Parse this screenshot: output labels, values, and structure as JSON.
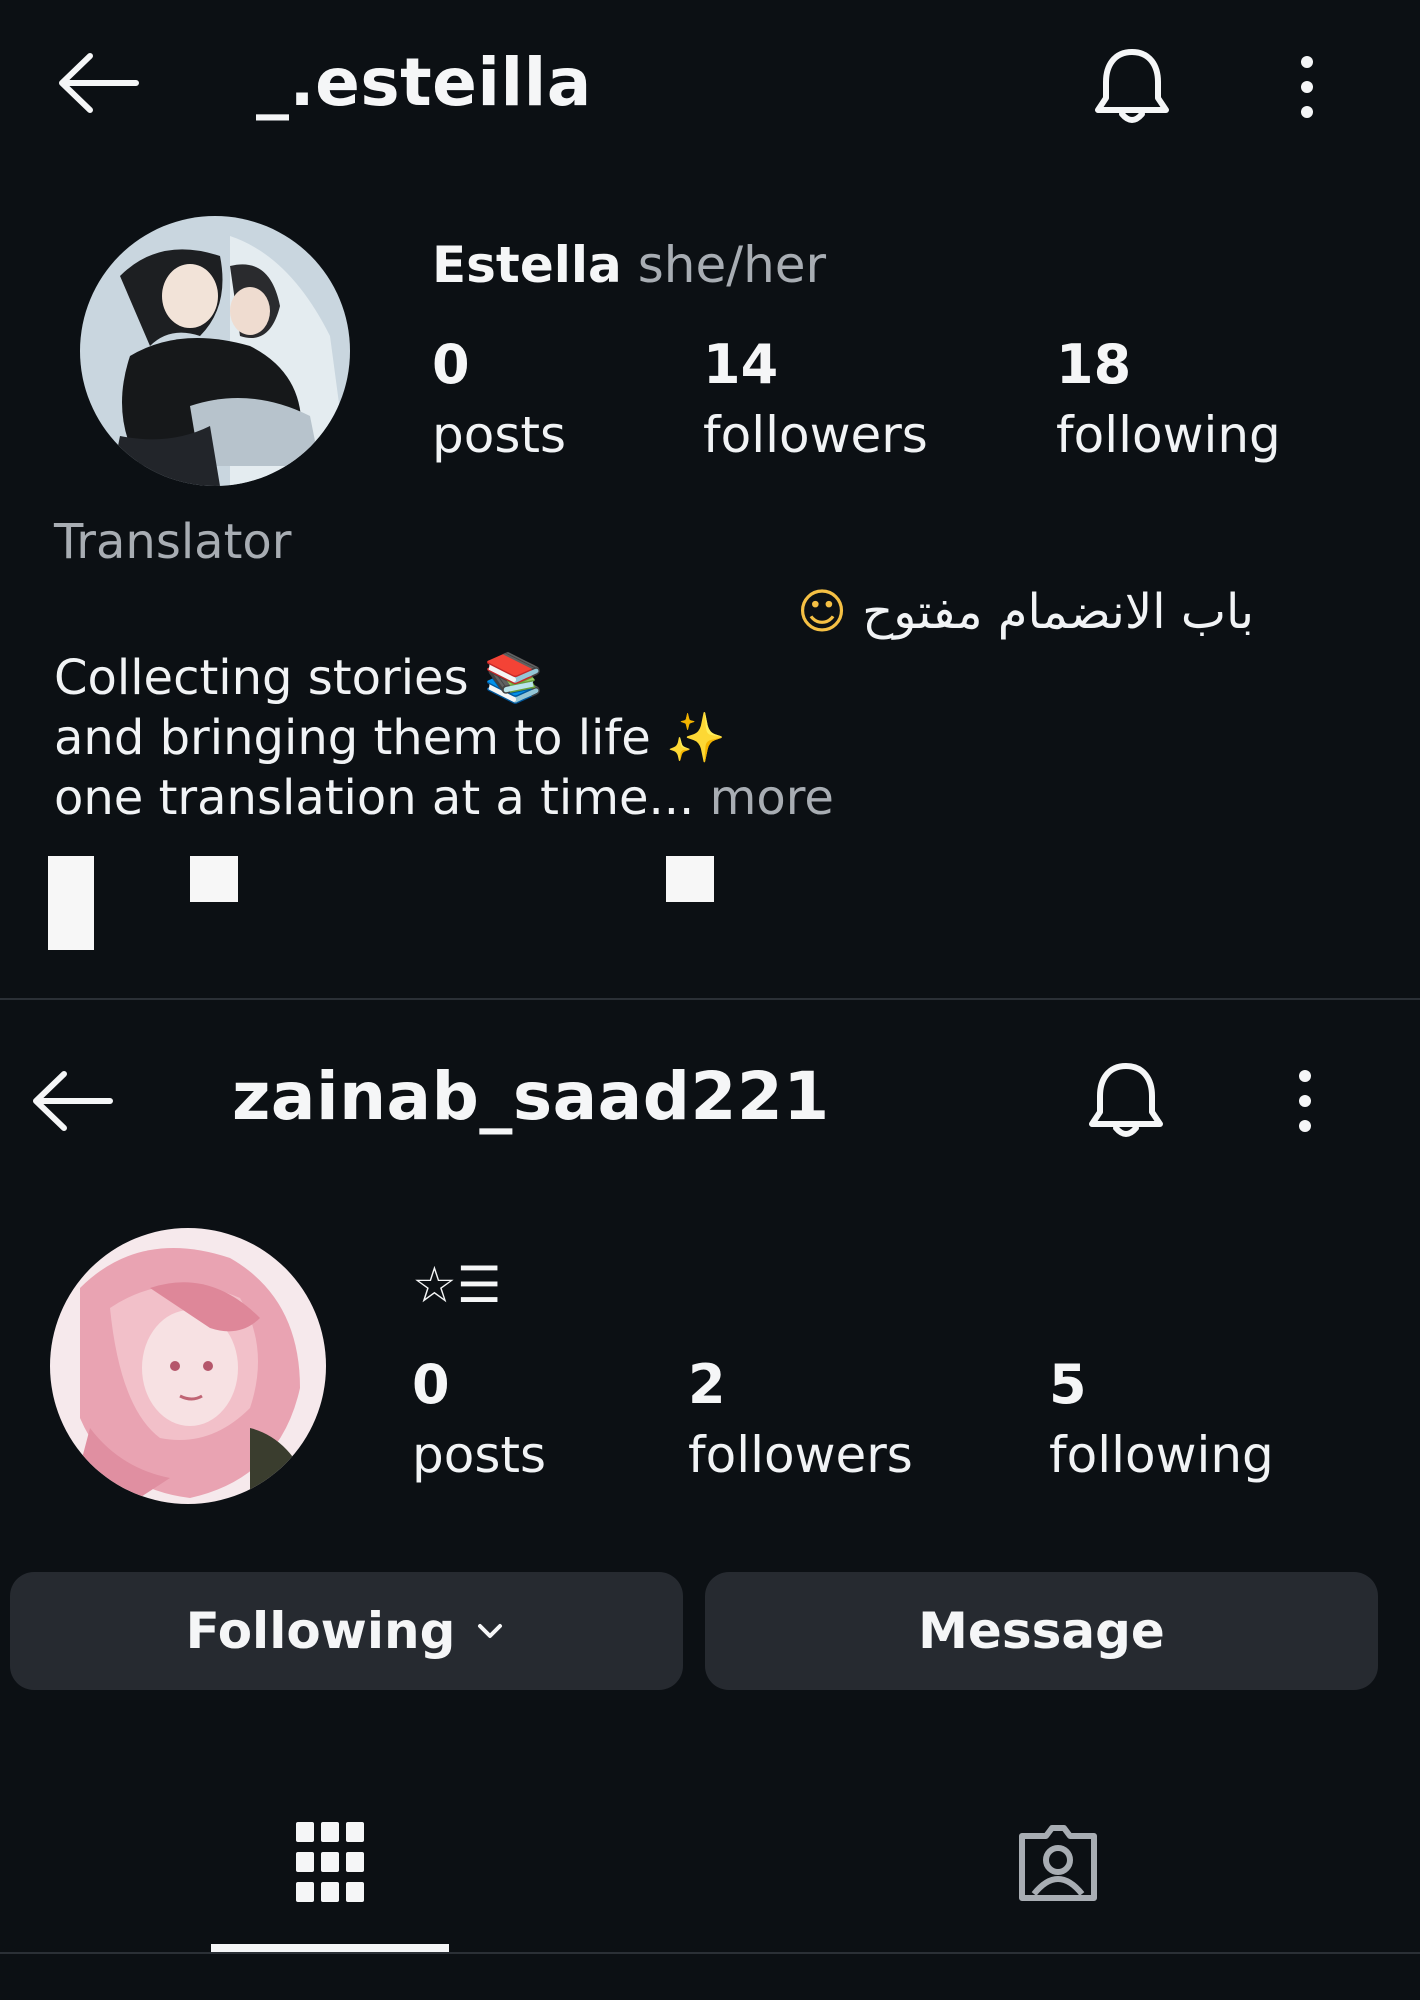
{
  "top_profile": {
    "username": "_.esteilla",
    "display_name": "Estella",
    "pronouns": "she/her",
    "stats": [
      {
        "value": "0",
        "label": "posts"
      },
      {
        "value": "14",
        "label": "followers"
      },
      {
        "value": "18",
        "label": "following"
      }
    ],
    "bio": {
      "category": "Translator",
      "arabic_line": "باب الانضمام مفتوح",
      "arabic_emoji": "☺",
      "line1": "Collecting stories",
      "line1_emoji": "📚",
      "line2": "and bringing them to life",
      "line2_emoji": "✨",
      "line3": "one translation at a time...",
      "more": "more"
    }
  },
  "bottom_profile": {
    "username": "zainab_saad221",
    "display_name": "☆☰",
    "stats": [
      {
        "value": "0",
        "label": "posts"
      },
      {
        "value": "2",
        "label": "followers"
      },
      {
        "value": "5",
        "label": "following"
      }
    ],
    "buttons": {
      "following": "Following",
      "message": "Message"
    }
  },
  "icons": {
    "back": "arrow-left-icon",
    "bell": "bell-icon",
    "more": "more-vertical-icon",
    "grid": "grid-icon",
    "tagged": "tagged-person-icon",
    "chevron": "chevron-down-icon"
  },
  "colors": {
    "background": "#0c1014",
    "button": "#262a30",
    "muted_text": "#a8adb3"
  }
}
